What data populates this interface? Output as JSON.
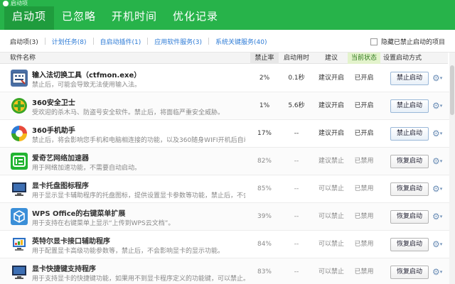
{
  "window": {
    "title": "启动项"
  },
  "main_tabs": [
    {
      "label": "启动项",
      "active": true
    },
    {
      "label": "已忽略",
      "active": false
    },
    {
      "label": "开机时间",
      "active": false
    },
    {
      "label": "优化记录",
      "active": false
    }
  ],
  "sub_tabs": [
    {
      "label": "启动项(3)"
    },
    {
      "label": "计划任务(8)"
    },
    {
      "label": "自启动插件(1)"
    },
    {
      "label": "应用软件服务(3)"
    },
    {
      "label": "系统关键服务(40)"
    }
  ],
  "hide_checkbox_label": "隐藏已禁止启动的项目",
  "columns": {
    "name": "软件名称",
    "load": "禁止率",
    "time": "启动用时",
    "advice": "建议",
    "state": "当前状态",
    "method": "设置启动方式"
  },
  "rows": [
    {
      "name": "输入法切换工具（ctfmon.exe）",
      "desc": "禁止后，可能会导致无法使用输入法。",
      "load": "2%",
      "time": "0.1秒",
      "advice": "建议开启",
      "state": "已开启",
      "action": "禁止启动",
      "icon": "keyboard-tool-icon",
      "icon_color": "#4a6fa5"
    },
    {
      "name": "360安全卫士",
      "desc": "受欢迎的杀木马、防盗号安全软件。禁止后，将面临严重安全威胁。",
      "load": "1%",
      "time": "5.6秒",
      "advice": "建议开启",
      "state": "已开启",
      "action": "禁止启动",
      "icon": "360-safe-icon",
      "icon_color": "#3aa526"
    },
    {
      "name": "360手机助手",
      "desc": "禁止后，将会影响您手机和电脑相连接的功能，以及360随身WIFI开机后自动的",
      "load": "17%",
      "time": "--",
      "advice": "建议开启",
      "state": "已开启",
      "action": "禁止启动",
      "icon": "360-mobile-icon",
      "icon_color": "#e84a3b"
    },
    {
      "name": "爱奇艺网络加速器",
      "desc": "用于网络加速功能，不需要自动启动。",
      "load": "82%",
      "time": "--",
      "advice": "建议禁止",
      "state": "已禁用",
      "action": "恢复启动",
      "icon": "iqiyi-icon",
      "icon_color": "#21b431"
    },
    {
      "name": "显卡托盘图标程序",
      "desc": "用于显示显卡辅助程序的托盘图标，提供设置显卡参数等功能，禁止后，不会影",
      "load": "85%",
      "time": "--",
      "advice": "可以禁止",
      "state": "已禁用",
      "action": "恢复启动",
      "icon": "monitor-icon",
      "icon_color": "#1d2f4f"
    },
    {
      "name": "WPS Office的右键菜单扩展",
      "desc": "用于支持在右键菜单上显示“上传到WPS云文档”。",
      "load": "39%",
      "time": "--",
      "advice": "可以禁止",
      "state": "已禁用",
      "action": "恢复启动",
      "icon": "cube-icon",
      "icon_color": "#3b8fd8"
    },
    {
      "name": "英特尔显卡接口辅助程序",
      "desc": "用于配置显卡高级功能参数等，禁止后，不会影响显卡的显示功能。",
      "load": "84%",
      "time": "--",
      "advice": "可以禁止",
      "state": "已禁用",
      "action": "恢复启动",
      "icon": "display-icon",
      "icon_color": "#2a6fc4"
    },
    {
      "name": "显卡快捷键支持程序",
      "desc": "用于支持显卡的快捷键功能，如果用不到显卡程序定义的功能键，可以禁止。",
      "load": "83%",
      "time": "--",
      "advice": "可以禁止",
      "state": "已禁用",
      "action": "恢复启动",
      "icon": "monitor-icon",
      "icon_color": "#1d2f4f"
    }
  ],
  "colors": {
    "brand": "#27b34a",
    "brand_dark": "#1f9c3d",
    "link": "#2d7bd6"
  }
}
